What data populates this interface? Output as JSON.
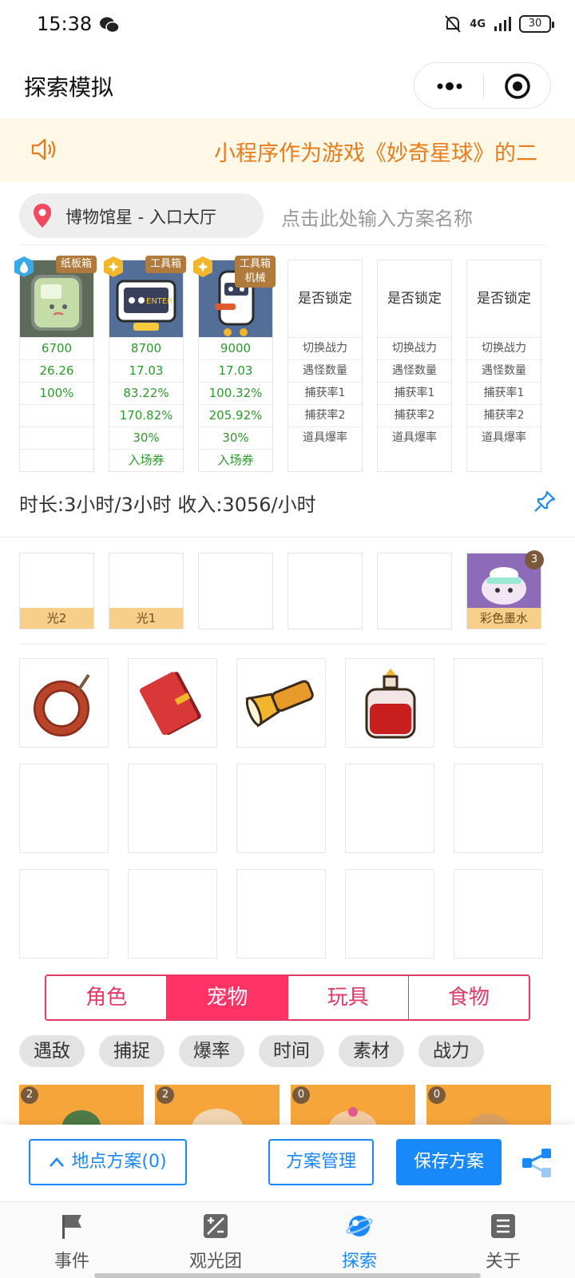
{
  "status_bar": {
    "time": "15:38",
    "network": "4G",
    "battery": "30"
  },
  "header": {
    "title": "探索模拟"
  },
  "notice": {
    "text": "小程序作为游戏《妙奇星球》的二"
  },
  "location": {
    "name": "博物馆星 - 入口大厅",
    "scheme_placeholder": "点击此处输入方案名称"
  },
  "characters": [
    {
      "tag": "纸板箱",
      "stats": [
        "6700",
        "26.26",
        "100%",
        "",
        "",
        ""
      ]
    },
    {
      "tag": "工具箱",
      "stats": [
        "8700",
        "17.03",
        "83.22%",
        "170.82%",
        "30%",
        "入场券"
      ]
    },
    {
      "tag": "工具箱\n机械",
      "stats": [
        "9000",
        "17.03",
        "100.32%",
        "205.92%",
        "30%",
        "入场券"
      ]
    }
  ],
  "empty_columns": {
    "head": "是否锁定",
    "rows": [
      "切换战力",
      "遇怪数量",
      "捕获率1",
      "捕获率2",
      "道具爆率"
    ]
  },
  "duration": {
    "text": "时长:3小时/3小时 收入:3056/小时"
  },
  "slots": [
    {
      "label": "光2"
    },
    {
      "label": "光1"
    },
    {
      "label": ""
    },
    {
      "label": ""
    },
    {
      "label": ""
    },
    {
      "label": "彩色墨水",
      "count": "3"
    }
  ],
  "items": [
    "sausage-ring-icon",
    "red-book-icon",
    "flashlight-icon",
    "red-potion-icon"
  ],
  "tabs": [
    "角色",
    "宠物",
    "玩具",
    "食物"
  ],
  "active_tab": "宠物",
  "filters": [
    "遇敌",
    "捕捉",
    "爆率",
    "时间",
    "素材",
    "战力"
  ],
  "pets": [
    {
      "count": "2"
    },
    {
      "count": "2"
    },
    {
      "count": "0"
    },
    {
      "count": "0"
    }
  ],
  "actions": {
    "location_scheme": "地点方案(0)",
    "manage": "方案管理",
    "save": "保存方案"
  },
  "nav": [
    {
      "label": "事件",
      "icon": "flag-icon"
    },
    {
      "label": "观光团",
      "icon": "calculator-icon"
    },
    {
      "label": "探索",
      "icon": "planet-icon"
    },
    {
      "label": "关于",
      "icon": "list-icon"
    }
  ],
  "colors": {
    "primary": "#1989fa",
    "accent": "#ff3366",
    "notice": "#e87b1c",
    "stat_green": "#2a9a2a"
  }
}
